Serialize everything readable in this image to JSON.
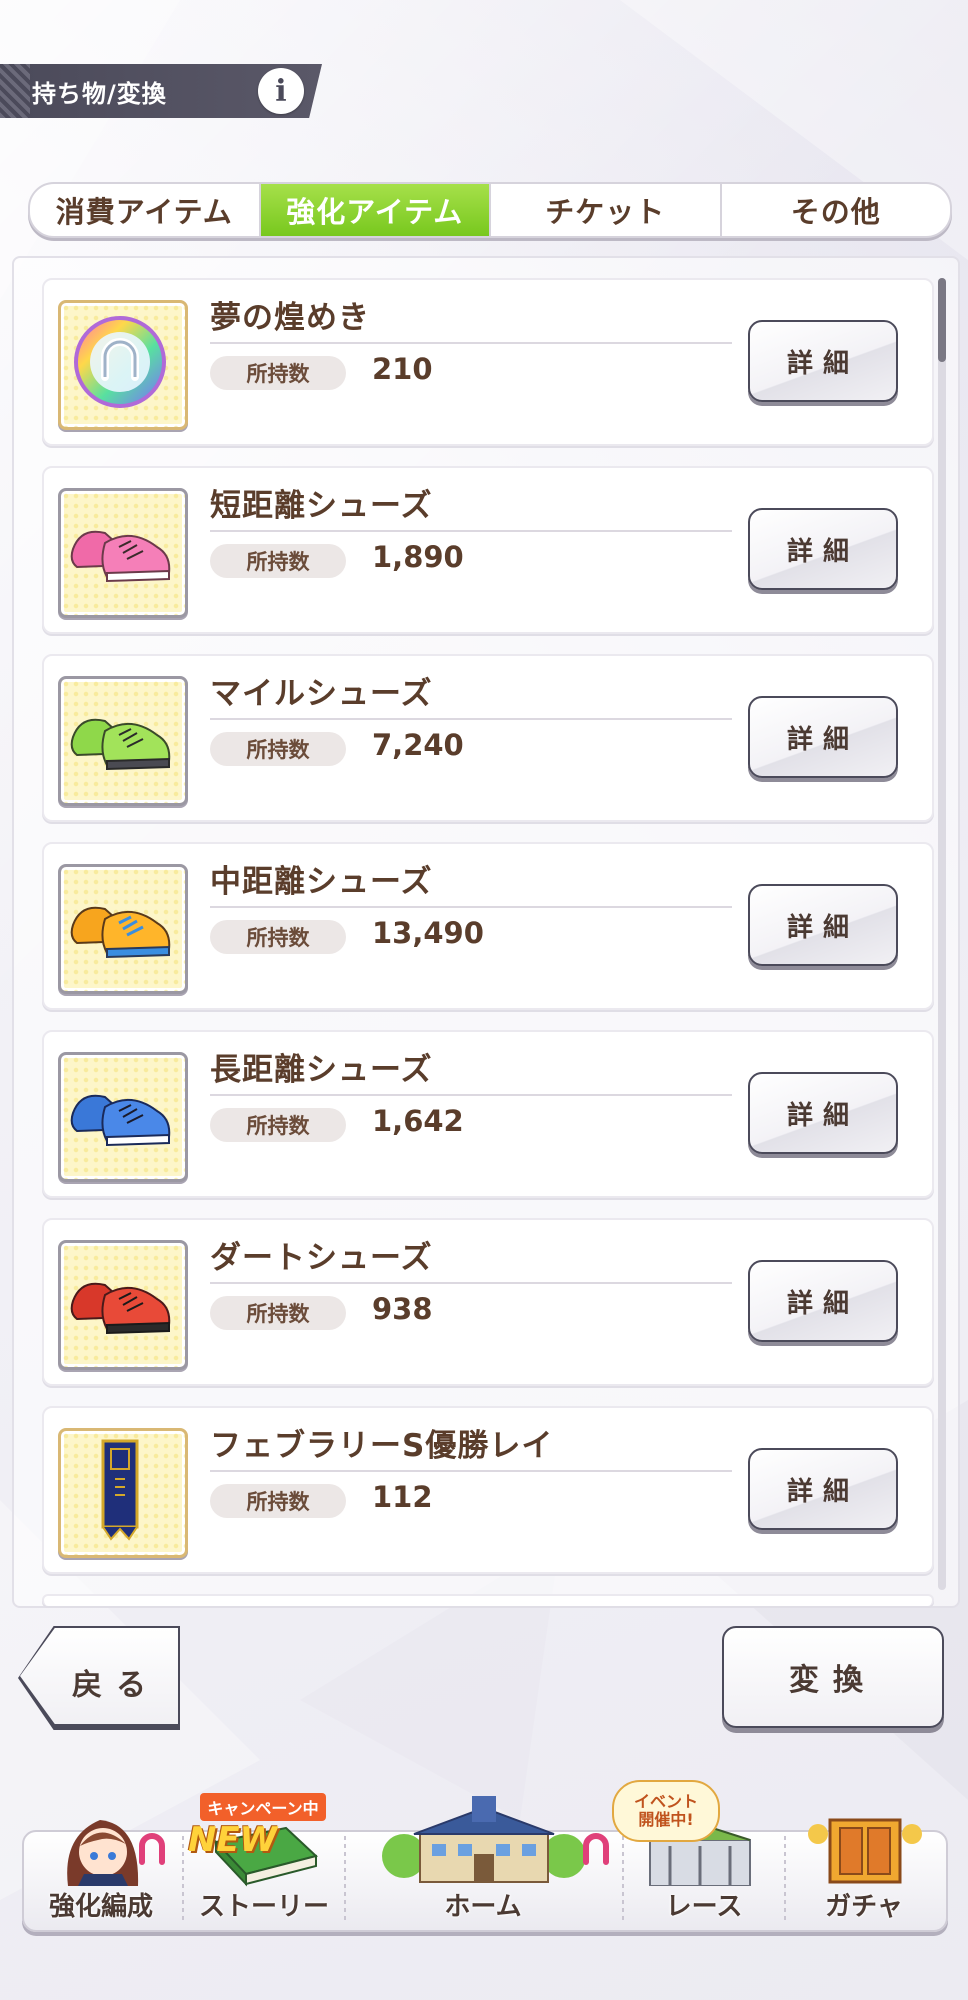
{
  "header": {
    "title": "持ち物/変換",
    "info_icon": "i"
  },
  "tabs": [
    {
      "label": "消費アイテム",
      "active": false
    },
    {
      "label": "強化アイテム",
      "active": true
    },
    {
      "label": "チケット",
      "active": false
    },
    {
      "label": "その他",
      "active": false
    }
  ],
  "items": [
    {
      "name": "夢の煌めき",
      "own_label": "所持数",
      "count": "210",
      "detail_label": "詳細",
      "icon": "rainbow-horseshoe-icon"
    },
    {
      "name": "短距離シューズ",
      "own_label": "所持数",
      "count": "1,890",
      "detail_label": "詳細",
      "icon": "pink-shoes-icon"
    },
    {
      "name": "マイルシューズ",
      "own_label": "所持数",
      "count": "7,240",
      "detail_label": "詳細",
      "icon": "green-shoes-icon"
    },
    {
      "name": "中距離シューズ",
      "own_label": "所持数",
      "count": "13,490",
      "detail_label": "詳細",
      "icon": "orange-shoes-icon"
    },
    {
      "name": "長距離シューズ",
      "own_label": "所持数",
      "count": "1,642",
      "detail_label": "詳細",
      "icon": "blue-shoes-icon"
    },
    {
      "name": "ダートシューズ",
      "own_label": "所持数",
      "count": "938",
      "detail_label": "詳細",
      "icon": "red-shoes-icon"
    },
    {
      "name": "フェブラリーS優勝レイ",
      "own_label": "所持数",
      "count": "112",
      "detail_label": "詳細",
      "icon": "winner-lei-icon"
    }
  ],
  "buttons": {
    "back": "戻る",
    "convert": "変換"
  },
  "nav": {
    "items": [
      {
        "label": "強化編成"
      },
      {
        "label": "ストーリー"
      },
      {
        "label": "ホーム"
      },
      {
        "label": "レース"
      },
      {
        "label": "ガチャ"
      }
    ],
    "campaign_badge": "キャンペーン中",
    "new_badge": "NEW",
    "event_badge_line1": "イベント",
    "event_badge_line2": "開催中!"
  },
  "colors": {
    "accent_green": "#8ed63a",
    "text_brown": "#5a3d2b",
    "header_dark": "#4b4a5a"
  }
}
